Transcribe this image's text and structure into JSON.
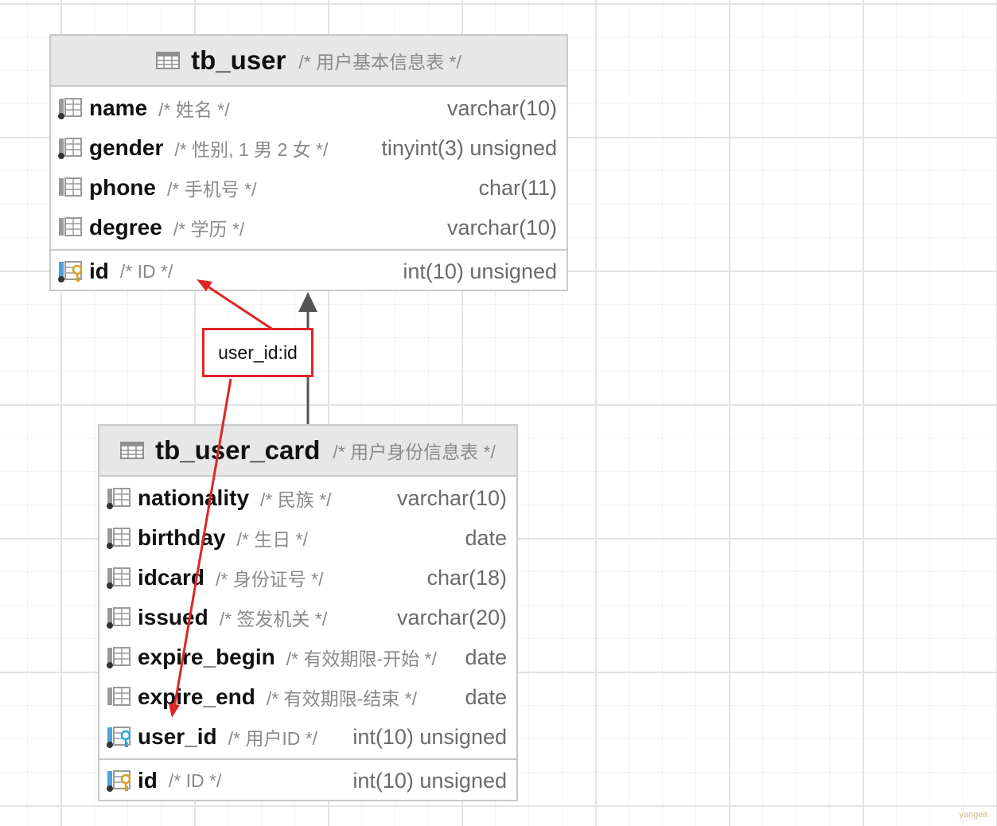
{
  "tables": {
    "user": {
      "name": "tb_user",
      "comment": "/* 用户基本信息表 */",
      "fields": [
        {
          "name": "name",
          "comment": "/* 姓名 */",
          "type": "varchar(10)"
        },
        {
          "name": "gender",
          "comment": "/* 性别, 1 男  2 女 */",
          "type": "tinyint(3) unsigned"
        },
        {
          "name": "phone",
          "comment": "/* 手机号 */",
          "type": "char(11)"
        },
        {
          "name": "degree",
          "comment": "/* 学历 */",
          "type": "varchar(10)"
        }
      ],
      "pk": {
        "name": "id",
        "comment": "/* ID */",
        "type": "int(10) unsigned"
      }
    },
    "card": {
      "name": "tb_user_card",
      "comment": "/* 用户身份信息表 */",
      "fields": [
        {
          "name": "nationality",
          "comment": "/* 民族 */",
          "type": "varchar(10)"
        },
        {
          "name": "birthday",
          "comment": "/* 生日 */",
          "type": "date"
        },
        {
          "name": "idcard",
          "comment": "/* 身份证号 */",
          "type": "char(18)"
        },
        {
          "name": "issued",
          "comment": "/* 签发机关 */",
          "type": "varchar(20)"
        },
        {
          "name": "expire_begin",
          "comment": "/* 有效期限-开始 */",
          "type": "date"
        },
        {
          "name": "expire_end",
          "comment": "/* 有效期限-结束 */",
          "type": "date"
        },
        {
          "name": "user_id",
          "comment": "/* 用户ID */",
          "type": "int(10) unsigned"
        }
      ],
      "pk": {
        "name": "id",
        "comment": "/* ID */",
        "type": "int(10) unsigned"
      }
    }
  },
  "relation": {
    "label": "user_id:id"
  },
  "colors": {
    "annotation": "#e02525",
    "connector": "#555555",
    "key_gold": "#e0a020",
    "key_blue": "#2aa7d8"
  },
  "watermark": "yangeit"
}
